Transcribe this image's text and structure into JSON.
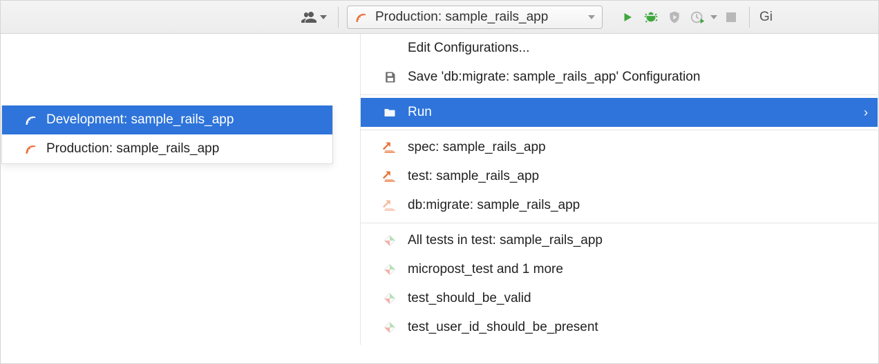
{
  "toolbar": {
    "config_label": "Production: sample_rails_app",
    "right_text": "Gi"
  },
  "submenu": {
    "items": [
      {
        "label": "Development: sample_rails_app",
        "selected": true
      },
      {
        "label": "Production: sample_rails_app",
        "selected": false
      }
    ]
  },
  "menu": {
    "edit": "Edit Configurations...",
    "save": "Save 'db:migrate: sample_rails_app' Configuration",
    "run": "Run",
    "group_rake": [
      "spec: sample_rails_app",
      "test: sample_rails_app",
      "db:migrate: sample_rails_app"
    ],
    "group_tests": [
      "All tests in test: sample_rails_app",
      "micropost_test and 1 more",
      "test_should_be_valid",
      "test_user_id_should_be_present"
    ]
  }
}
